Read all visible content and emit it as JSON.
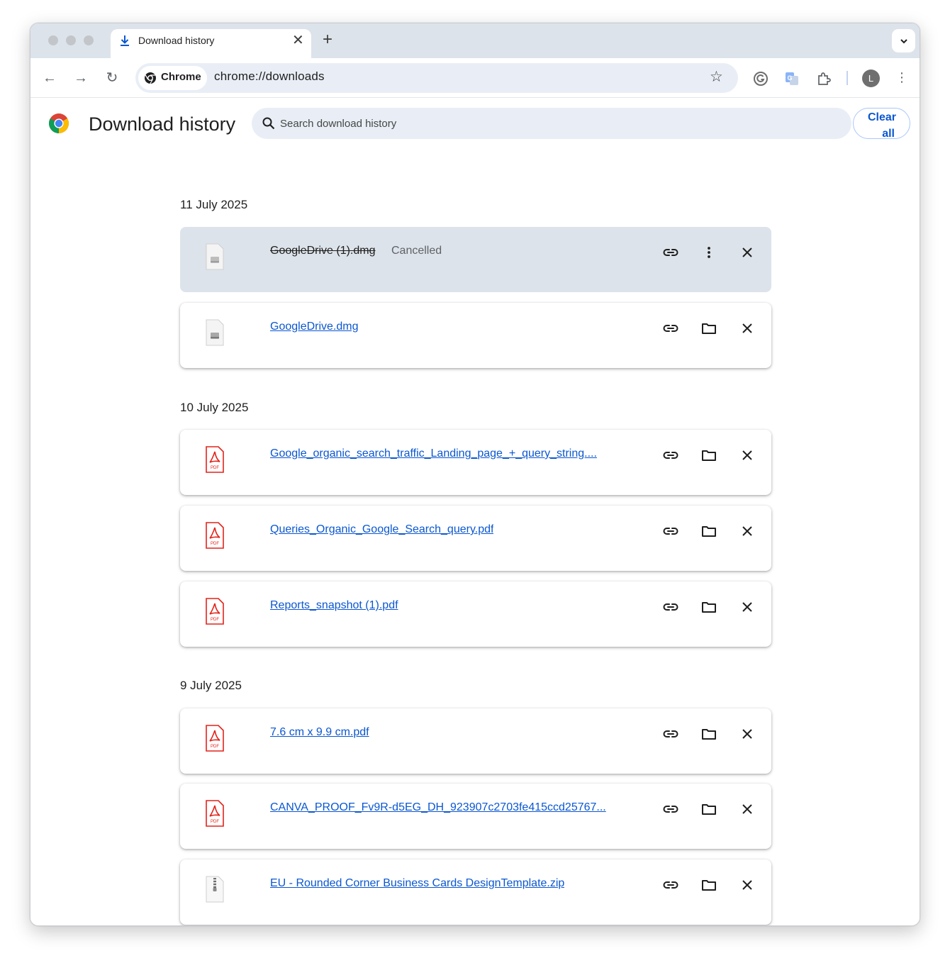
{
  "browser": {
    "tab_title": "Download history",
    "omnibox_chip": "Chrome",
    "url": "chrome://downloads",
    "avatar_letter": "L"
  },
  "page": {
    "title": "Download history",
    "search_placeholder": "Search download history",
    "clear_all_line1": "Clear",
    "clear_all_line2": "all"
  },
  "groups": [
    {
      "date": "11 July 2025",
      "items": [
        {
          "name": "GoogleDrive (1).dmg",
          "status": "Cancelled",
          "type": "dmg",
          "cancelled": true
        },
        {
          "name": "GoogleDrive.dmg",
          "status": "",
          "type": "dmg",
          "cancelled": false
        }
      ]
    },
    {
      "date": "10 July 2025",
      "items": [
        {
          "name": "Google_organic_search_traffic_Landing_page_+_query_string....",
          "type": "pdf"
        },
        {
          "name": "Queries_Organic_Google_Search_query.pdf",
          "type": "pdf"
        },
        {
          "name": "Reports_snapshot (1).pdf",
          "type": "pdf"
        }
      ]
    },
    {
      "date": "9 July 2025",
      "items": [
        {
          "name": "7.6 cm x 9.9 cm.pdf",
          "type": "pdf"
        },
        {
          "name": "CANVA_PROOF_Fv9R-d5EG_DH_923907c2703fe415ccd25767...",
          "type": "pdf"
        },
        {
          "name": "EU - Rounded Corner Business Cards DesignTemplate.zip",
          "type": "zip"
        }
      ]
    }
  ],
  "colors": {
    "accent": "#0b57d0",
    "cancelled_card": "#dde3ea",
    "tabstrip": "#dde3ea",
    "pdf_red": "#e2231a"
  }
}
